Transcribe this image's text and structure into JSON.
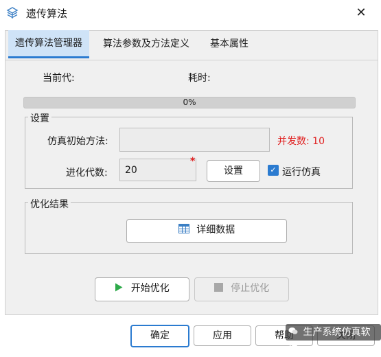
{
  "window": {
    "title": "遗传算法",
    "close_glyph": "✕"
  },
  "tabs": [
    {
      "label": "遗传算法管理器",
      "active": true
    },
    {
      "label": "算法参数及方法定义",
      "active": false
    },
    {
      "label": "基本属性",
      "active": false
    }
  ],
  "status": {
    "current_gen_label": "当前代:",
    "time_label": "耗时:"
  },
  "progress": {
    "value": 0,
    "text": "0%"
  },
  "settings": {
    "title": "设置",
    "init_method_label": "仿真初始方法:",
    "init_method_value": "",
    "concurrency_text": "并发数: 10",
    "generations_label": "进化代数:",
    "generations_value": "20",
    "required_mark": "*",
    "set_button": "设置",
    "run_sim_label": "运行仿真",
    "run_sim_checked": true
  },
  "results": {
    "title": "优化结果",
    "detail_button": "详细数据"
  },
  "actions": {
    "start": "开始优化",
    "stop": "停止优化"
  },
  "footer": {
    "ok": "确定",
    "apply": "应用",
    "help": "帮助",
    "close": "关闭"
  },
  "watermark": "生产系统仿真软件",
  "colors": {
    "accent": "#2b7bd0",
    "warning_text": "#e02020",
    "start_icon": "#2eaa4a"
  }
}
